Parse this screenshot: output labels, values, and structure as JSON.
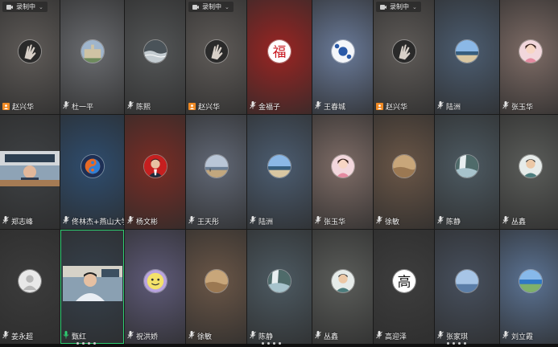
{
  "recording_label": "录制中",
  "tiles": [
    {
      "name": "赵兴华",
      "bg": "#5f5b58",
      "avatar": "dark-hand",
      "badge": "rec",
      "rec": true
    },
    {
      "name": "杜一平",
      "bg": "#6a6c70",
      "avatar": "building",
      "badge": "mic"
    },
    {
      "name": "陈熙",
      "bg": "#545657",
      "avatar": "water-dark",
      "badge": "mic"
    },
    {
      "name": "赵兴华",
      "bg": "#5f5b58",
      "avatar": "dark-hand",
      "badge": "rec",
      "rec": true
    },
    {
      "name": "金福子",
      "bg": "#9b2422",
      "avatar": "fu-red",
      "badge": "mic"
    },
    {
      "name": "王春城",
      "bg": "#6a7b9a",
      "avatar": "blue-porcelain",
      "badge": "mic"
    },
    {
      "name": "赵兴华",
      "bg": "#5f5b58",
      "avatar": "dark-hand",
      "badge": "rec",
      "rec": true
    },
    {
      "name": "陆洲",
      "bg": "#4c5d71",
      "avatar": "beach",
      "badge": "mic"
    },
    {
      "name": "张玉华",
      "bg": "#7e6c66",
      "avatar": "woman",
      "badge": "mic"
    },
    {
      "name": "郑志峰",
      "bg": "#3f4245",
      "avatar": "classroom",
      "badge": "mic",
      "rect": true
    },
    {
      "name": "佟林杰+燕山大学",
      "bg": "#2e4d6f",
      "avatar": "yinyang",
      "badge": "mic"
    },
    {
      "name": "杨文彬",
      "bg": "#7a2d25",
      "avatar": "man-red",
      "badge": "mic"
    },
    {
      "name": "王天彤",
      "bg": "#616876",
      "avatar": "sunset-beach",
      "badge": "mic"
    },
    {
      "name": "陆洲",
      "bg": "#4c5d71",
      "avatar": "beach",
      "badge": "mic"
    },
    {
      "name": "张玉华",
      "bg": "#7e6c66",
      "avatar": "woman",
      "badge": "mic"
    },
    {
      "name": "徐敏",
      "bg": "#6a5647",
      "avatar": "sand",
      "badge": "mic"
    },
    {
      "name": "陈静",
      "bg": "#4d5a62",
      "avatar": "waterfall",
      "badge": "mic"
    },
    {
      "name": "丛鑫",
      "bg": "#5b5d5a",
      "avatar": "man-cartoon",
      "badge": "mic"
    },
    {
      "name": "姜永超",
      "bg": "#3c3c3c",
      "avatar": "default",
      "badge": "mic"
    },
    {
      "name": "甄红",
      "bg": "#36414d",
      "avatar": "classroom-man",
      "badge": "mic-green",
      "rect": true,
      "active": true
    },
    {
      "name": "祝洪娇",
      "bg": "#5e5a78",
      "avatar": "emoji",
      "badge": "mic"
    },
    {
      "name": "徐敏",
      "bg": "#6a5647",
      "avatar": "sand",
      "badge": "mic"
    },
    {
      "name": "陈静",
      "bg": "#4d5a62",
      "avatar": "waterfall",
      "badge": "mic"
    },
    {
      "name": "丛鑫",
      "bg": "#5b5d5a",
      "avatar": "man-cartoon",
      "badge": "mic"
    },
    {
      "name": "高迎泽",
      "bg": "#3e3e3e",
      "avatar": "calligraphy",
      "badge": "mic"
    },
    {
      "name": "张家琪",
      "bg": "#47505e",
      "avatar": "sky",
      "badge": "mic"
    },
    {
      "name": "刘立霞",
      "bg": "#5b7394",
      "avatar": "coast",
      "badge": "mic"
    }
  ]
}
